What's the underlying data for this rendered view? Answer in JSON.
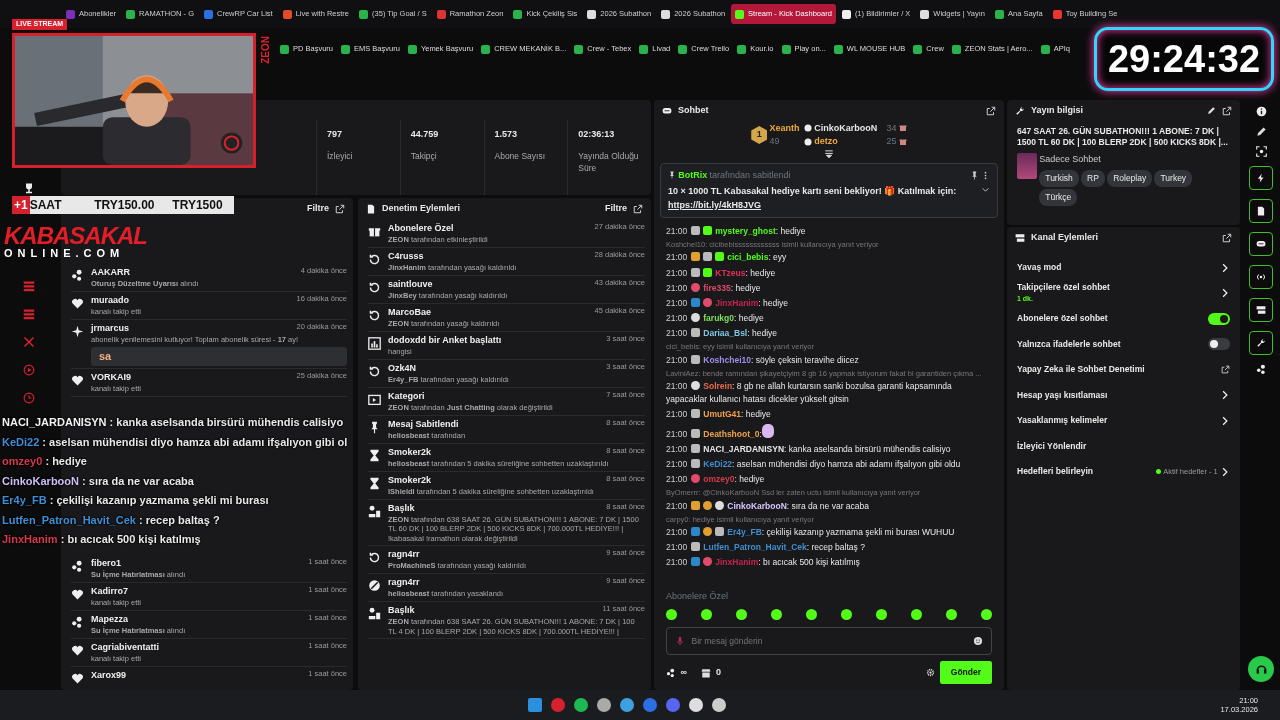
{
  "browser": {
    "tabs": [
      {
        "label": "Abonelikler",
        "selected": false
      },
      {
        "label": "RAMATHON - G",
        "selected": false
      },
      {
        "label": "CrewRP Car List",
        "selected": false
      },
      {
        "label": "Live with Restre",
        "selected": false
      },
      {
        "label": "(35) Tip Goal / S",
        "selected": false
      },
      {
        "label": "Ramathon Zeon",
        "selected": false
      },
      {
        "label": "Kick Çekiliş Sis",
        "selected": false
      },
      {
        "label": "2026 Subathon",
        "selected": false
      },
      {
        "label": "2026 Subathon",
        "selected": false
      },
      {
        "label": "Stream - Kick Dashboard",
        "selected": true
      },
      {
        "label": "(1) Bildirimler / X",
        "selected": false
      },
      {
        "label": "Widgets | Yayın",
        "selected": false
      },
      {
        "label": "Ana Sayfa",
        "selected": false
      },
      {
        "label": "Toy Building Se",
        "selected": false
      }
    ],
    "bookmarks": [
      "PD Başvuru",
      "EMS Başvuru",
      "Yemek Başvuru",
      "CREW MEKANİK B...",
      "Crew - Tebex",
      "Livad",
      "Crew Trello",
      "Kour.io",
      "Play on...",
      "WL MOUSE HUB",
      "Crew",
      "ZEON Stats | Aero...",
      "APIq"
    ]
  },
  "overlay": {
    "live_badge": "LIVE STREAM",
    "side_label": "ZEON",
    "timer": "29:24:32",
    "price_banner": {
      "badge": "+1",
      "label": "SAAT",
      "prices": [
        "TRY150.00",
        "TRY1500"
      ]
    },
    "logo": {
      "line1": "KABASAKAL",
      "line2": "ONLINE.COM"
    },
    "chat": [
      {
        "user": "NACI_JARDANISYN",
        "color": "#f2f2f2",
        "text": ": kanka aselsanda birsürü mühendis calisiyo"
      },
      {
        "user": "KeDi22",
        "color": "#3f8fd6",
        "text": ": aselsan mühendisi diyo hamza abi adamı ifşalıyon gibi ol"
      },
      {
        "user": "omzey0",
        "color": "#d8394c",
        "text": ": hediye"
      },
      {
        "user": "CinkoKarbooN",
        "color": "#cdbff5",
        "text": ": sıra da ne var acaba"
      },
      {
        "user": "Er4y_FB",
        "color": "#3f8fd6",
        "text": ": çekilişi kazanıp yazmama şekli mi burası"
      },
      {
        "user": "Lutfen_Patron_Havit_Cek",
        "color": "#3f8fd6",
        "text": ": recep baltaş ?"
      },
      {
        "user": "JinxHanim",
        "color": "#d8394c",
        "text": ": bı acıcak 500 kişi katılmış"
      }
    ]
  },
  "stats": [
    {
      "value": "797",
      "label": "İzleyici"
    },
    {
      "value": "44.759",
      "label": "Takipçi"
    },
    {
      "value": "1.573",
      "label": "Abone Sayısı"
    },
    {
      "value": "02:36:13",
      "label": "Yayında Olduğu Süre"
    }
  ],
  "activity": {
    "filter": "Filtre",
    "items": [
      {
        "kind": "gap"
      },
      {
        "kind": "reward",
        "user": "AAKARR",
        "time": "4 dakika önce",
        "detail": "**Oturuş Düzeltme Uyarısı** alındı"
      },
      {
        "kind": "follow",
        "user": "muraado",
        "time": "16 dakika önce",
        "detail": "kanalı takip etti"
      },
      {
        "kind": "sub",
        "user": "jrmarcus",
        "time": "20 dakika önce",
        "detail": "abonelik yenilemesini kutluyor! Toplam abonelik süresi - **17** ay!",
        "emote": "sa"
      },
      {
        "kind": "follow",
        "user": "VORKAI9",
        "time": "25 dakika önce",
        "detail": "kanalı takip etti"
      },
      {
        "kind": "gap"
      },
      {
        "kind": "reward",
        "user": "fibero1",
        "time": "1 saat önce",
        "detail": "**Su İçme Hatırlatması** alındı"
      },
      {
        "kind": "follow",
        "user": "Kadirro7",
        "time": "1 saat önce",
        "detail": "kanalı takip etti"
      },
      {
        "kind": "reward",
        "user": "Mapezza",
        "time": "1 saat önce",
        "detail": "**Su İçme Hatırlatması** alındı"
      },
      {
        "kind": "follow",
        "user": "Cagriabiventatti",
        "time": "1 saat önce",
        "detail": "kanalı takip etti"
      },
      {
        "kind": "follow",
        "user": "Xarox99",
        "time": "1 saat önce"
      }
    ]
  },
  "moderation": {
    "title": "Denetim Eylemleri",
    "filter": "Filtre",
    "items": [
      {
        "kind": "gift",
        "title": "Abonelere Özel",
        "time": "27 dakika önce",
        "detail": "**ZEON** tarafından etkinleştirildi"
      },
      {
        "kind": "unban",
        "title": "C4russs",
        "time": "28 dakika önce",
        "detail": "**JinxHanim** tarafından yasağı kaldırıldı"
      },
      {
        "kind": "unban",
        "title": "saintlouve",
        "time": "43 dakika önce",
        "detail": "**JinxBey** tarafından yasağı kaldırıldı"
      },
      {
        "kind": "unban",
        "title": "MarcoBae",
        "time": "45 dakika önce",
        "detail": "**ZEON** tarafından yasağı kaldırıldı"
      },
      {
        "kind": "poll",
        "title": "**dodoxdd** bir Anket başlattı",
        "time": "3 saat önce",
        "detail": "hangisi"
      },
      {
        "kind": "unban",
        "title": "Ozk4N",
        "time": "3 saat önce",
        "detail": "**Er4y_FB** tarafından yasağı kaldırıldı"
      },
      {
        "kind": "category",
        "title": "Kategori",
        "time": "7 saat önce",
        "detail": "**ZEON** tarafından **Just Chatting** olarak değiştirildi"
      },
      {
        "kind": "pin",
        "title": "Mesaj Sabitlendi",
        "time": "8 saat önce",
        "detail": "**heliosbeast** tarafından"
      },
      {
        "kind": "timeout",
        "title": "Smoker2k",
        "time": "8 saat önce",
        "detail": "**heliosbeast** tarafından 5 dakika süreliğine sohbetten uzaklaştırıldı"
      },
      {
        "kind": "timeout",
        "title": "Smoker2k",
        "time": "8 saat önce",
        "detail": "**lShieldl** tarafından 5 dakika süreliğine sohbetten uzaklaştırıldı"
      },
      {
        "kind": "title",
        "title": "Başlık",
        "time": "8 saat önce",
        "detail": "**ZEON** tarafından 638 SAAT 26. GÜN SUBATHON!!! 1 ABONE: 7 DK | 1500 TL 60 DK | 100 BLERP 2DK | 500 KICKS 8DK | 700.000TL HEDİYE!!! | !kabasakal !ramathon olarak değiştirildi"
      },
      {
        "kind": "unban",
        "title": "ragn4rr",
        "time": "9 saat önce",
        "detail": "**ProMachineS** tarafından yasağı kaldırıldı"
      },
      {
        "kind": "ban",
        "title": "ragn4rr",
        "time": "9 saat önce",
        "detail": "**heliosbeast** tarafından yasaklandı"
      },
      {
        "kind": "title",
        "title": "Başlık",
        "time": "11 saat önce",
        "detail": "**ZEON** tarafından 638 SAAT 26. GÜN SUBATHON!!! 1 ABONE: 7 DK | 100 TL 4 DK | 100 BLERP 2DK | 500 KICKS 8DK | 700.000TL HEDİYE!!! |"
      }
    ]
  },
  "chat": {
    "title": "Sohbet",
    "leaders": [
      {
        "rank": "1",
        "user": "Xeanth",
        "count": "49",
        "color": "#f0a93b"
      },
      {
        "user": "CinkoKarbooN",
        "count": "34",
        "color": "#e6e6e6"
      },
      {
        "user": "detzo",
        "count": "25",
        "color": "#f0a93b"
      }
    ],
    "pinned": {
      "by": "BotRix",
      "by_text": "tarafından sabitlendi",
      "text": "10 × 1000 TL Kabasakal hediye kartı seni bekliyor! 🎁 Katılmak için:",
      "link": "https://bit.ly/4kH8JVG"
    },
    "messages": [
      {
        "time": "21:00",
        "user": "mystery_ghost",
        "color": "#53fc18",
        "badges": [
          {
            "kind": "mod"
          },
          {
            "kind": "gift"
          }
        ],
        "text": ": hediye"
      },
      {
        "reply": "Koshchei10: cicibebissssssssssss isimli kullanıcıya yanıt veriyor",
        "time": "21:00",
        "user": "cici_bebis",
        "color": "#53fc18",
        "badges": [
          {
            "kind": "vip"
          },
          {
            "kind": "mod"
          },
          {
            "kind": "gift"
          }
        ],
        "text": ": eyy"
      },
      {
        "time": "21:00",
        "user": "KTzeus",
        "color": "#e0315b",
        "badges": [
          {
            "kind": "mod"
          },
          {
            "kind": "gift"
          }
        ],
        "text": ": hediye"
      },
      {
        "time": "21:00",
        "user": "fire335",
        "color": "#e0476b",
        "badges": [
          {
            "kind": "sub"
          }
        ],
        "text": ": hediye"
      },
      {
        "time": "21:00",
        "user": "JinxHanim",
        "color": "#c42450",
        "badges": [
          {
            "kind": "bot"
          },
          {
            "kind": "sub"
          }
        ],
        "text": ": hediye"
      },
      {
        "time": "21:00",
        "user": "farukg0",
        "color": "#7fe05a",
        "badges": [
          {
            "kind": "verified"
          }
        ],
        "text": ": hediye"
      },
      {
        "time": "21:00",
        "user": "Dariaa_Bsl",
        "color": "#7ec8e3",
        "badges": [
          {
            "kind": "mod"
          }
        ],
        "text": ": hediye"
      },
      {
        "reply": "cici_bebis: eyy isimli kullanıcıya yanıt veriyor",
        "time": "21:00",
        "user": "Koshchei10",
        "color": "#9b8fe8",
        "badges": [
          {
            "kind": "mod"
          }
        ],
        "text": ": söyle çeksin teravihe diicez"
      },
      {
        "reply": "LaviniAez: bende ramından şikayetçiyim 8 gb 16 yapmak istiyorum fakat bi garantiden çıkma ...",
        "time": "21:00",
        "user": "Solrein",
        "color": "#e86a4a",
        "badges": [
          {
            "kind": "verified"
          }
        ],
        "text": ": 8 gb ne allah kurtarsın sanki bozulsa garanti kapsamında yapacaklar kullanıcı hatası dicekler yükselt gitsin"
      },
      {
        "time": "21:00",
        "user": "UmutG41",
        "color": "#f0a04b",
        "badges": [
          {
            "kind": "mod"
          }
        ],
        "text": ": hediye"
      },
      {
        "time": "21:00",
        "user": "Deathshoot_0",
        "color": "#f0a04b",
        "badges": [
          {
            "kind": "mod"
          }
        ],
        "text": ":",
        "emote": true
      },
      {
        "time": "21:00",
        "user": "NACI_JARDANISYN",
        "color": "#e8e8e8",
        "badges": [
          {
            "kind": "mod"
          }
        ],
        "text": ": kanka aselsanda birsürü mühendis calisiyo"
      },
      {
        "time": "21:00",
        "user": "KeDi22",
        "color": "#3e8ed0",
        "badges": [
          {
            "kind": "mod"
          }
        ],
        "text": ": aselsan mühendisi diyo hamza abi adamı ifşalıyon gibi oldu"
      },
      {
        "time": "21:00",
        "user": "omzey0",
        "color": "#d03a4a",
        "badges": [
          {
            "kind": "sub"
          }
        ],
        "text": ": hediye"
      },
      {
        "reply": "ByOmerrr: @CinkoKarbooN Ssd ler zaten uctu isimli kullanıcıya yanıt veriyor",
        "time": "21:00",
        "user": "CinkoKarbooN",
        "color": "#d6c8ff",
        "badges": [
          {
            "kind": "vip"
          },
          {
            "kind": "og"
          },
          {
            "kind": "verified"
          }
        ],
        "text": ": sıra da ne var acaba"
      },
      {
        "reply": "carpy0: hediye isimli kullanıcıya yanıt veriyor",
        "time": "21:00",
        "user": "Er4y_FB",
        "color": "#3e8ed0",
        "badges": [
          {
            "kind": "bot"
          },
          {
            "kind": "og"
          },
          {
            "kind": "mod"
          }
        ],
        "text": ": çekilişi kazanıp yazmama şekli mi burası WUHUU"
      },
      {
        "time": "21:00",
        "user": "Lutfen_Patron_Havit_Cek",
        "color": "#3e8ed0",
        "badges": [
          {
            "kind": "mod"
          }
        ],
        "text": ": recep baltaş ?"
      },
      {
        "time": "21:00",
        "user": "JinxHanim",
        "color": "#c42450",
        "badges": [
          {
            "kind": "bot"
          },
          {
            "kind": "sub"
          }
        ],
        "text": ": bı acıcak 500 kişi katılmış"
      }
    ],
    "emote_label": "Abonelere Özel",
    "input": {
      "placeholder": "Bir mesaj gönderin"
    },
    "points": "∞",
    "drops": "0",
    "send": "Gönder"
  },
  "stream_info": {
    "title": "Yayın bilgisi",
    "stream_title": "647 SAAT 26. GÜN SUBATHON!!! 1 ABONE: 7 DK | 1500 TL 60 DK | 100 BLERP 2DK | 500 KICKS 8DK |...",
    "category": "Sadece Sohbet",
    "tags": [
      "Turkish",
      "RP",
      "Roleplay",
      "Turkey",
      "Türkçe"
    ]
  },
  "channel_actions": {
    "title": "Kanal Eylemleri",
    "items": [
      {
        "kind": "arrow",
        "label": "Yavaş mod"
      },
      {
        "kind": "arrow",
        "label": "Takipçilere özel sohbet",
        "sub": "1 dk."
      },
      {
        "kind": "toggle",
        "label": "Abonelere özel sohbet",
        "on": true
      },
      {
        "kind": "toggle",
        "label": "Yalnızca ifadelerle sohbet",
        "on": false
      },
      {
        "kind": "external",
        "label": "Yapay Zeka ile Sohbet Denetimi"
      },
      {
        "kind": "arrow",
        "label": "Hesap yaşı kısıtlaması"
      },
      {
        "kind": "arrow",
        "label": "Yasaklanmış kelimeler"
      },
      {
        "kind": "plain",
        "label": "İzleyici Yönlendir"
      },
      {
        "kind": "arrow",
        "label": "Hedefleri belirleyin",
        "status": "Aktif hedefler - 1"
      }
    ]
  },
  "taskbar": {
    "time": "21:00",
    "date": "17.03.2026"
  }
}
